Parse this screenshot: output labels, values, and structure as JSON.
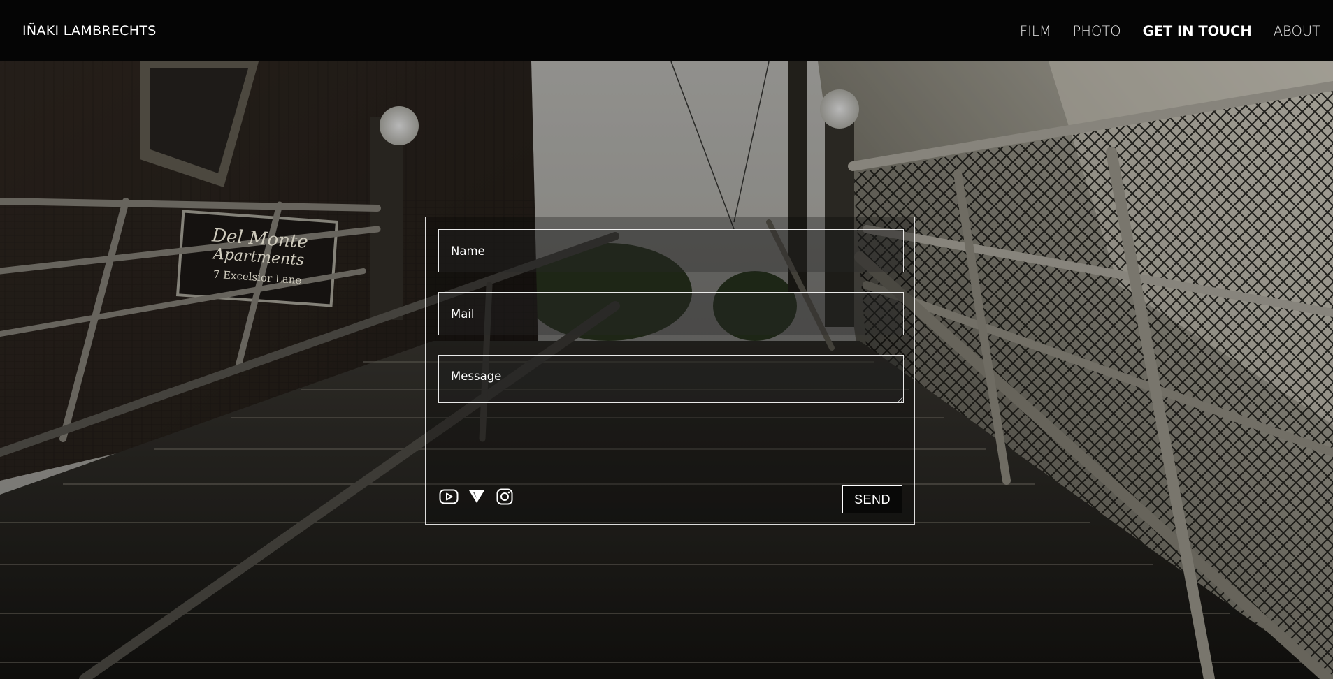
{
  "site": {
    "brand": "IÑAKI LAMBRECHTS"
  },
  "nav": {
    "items": [
      {
        "label": "FILM",
        "active": false
      },
      {
        "label": "PHOTO",
        "active": false
      },
      {
        "label": "GET IN TOUCH",
        "active": true
      },
      {
        "label": "ABOUT",
        "active": false
      }
    ]
  },
  "hero": {
    "sign_line1": "Del Monte",
    "sign_line2": "Apartments",
    "sign_line3": "7 Excelsior Lane"
  },
  "form": {
    "name_placeholder": "Name",
    "mail_placeholder": "Mail",
    "message_placeholder": "Message",
    "send_label": "SEND",
    "social_icons": [
      "youtube-icon",
      "vimeo-icon",
      "instagram-icon"
    ]
  },
  "colors": {
    "nav_background": "#050505",
    "text": "#ffffff",
    "border": "#ffffff"
  }
}
